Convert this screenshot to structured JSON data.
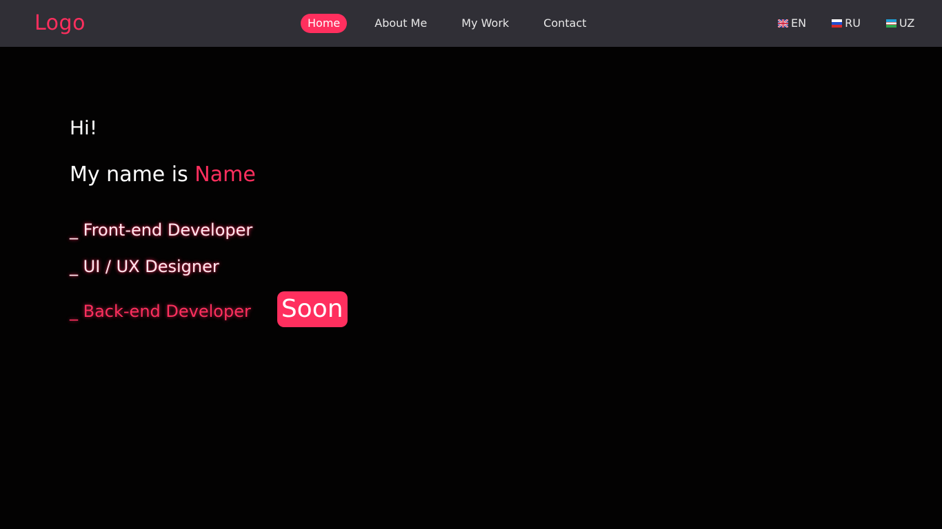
{
  "brand": {
    "logo_text": "Logo"
  },
  "nav": {
    "links": [
      {
        "label": "Home",
        "active": true
      },
      {
        "label": "About Me",
        "active": false
      },
      {
        "label": "My Work",
        "active": false
      },
      {
        "label": "Contact",
        "active": false
      }
    ]
  },
  "languages": [
    {
      "code": "EN",
      "flag": "uk-flag-icon"
    },
    {
      "code": "RU",
      "flag": "russia-flag-icon"
    },
    {
      "code": "UZ",
      "flag": "uzbekistan-flag-icon"
    }
  ],
  "hero": {
    "greeting": "Hi!",
    "intro_prefix": "My name is ",
    "intro_name": "Name",
    "roles": [
      "_ Front-end Developer",
      "_ UI / UX Designer",
      "_ Back-end Developer"
    ],
    "soon_badge": "Soon"
  },
  "colors": {
    "accent": "#ff2f5e",
    "navbar_bg": "#302f36",
    "page_bg": "#030202"
  }
}
